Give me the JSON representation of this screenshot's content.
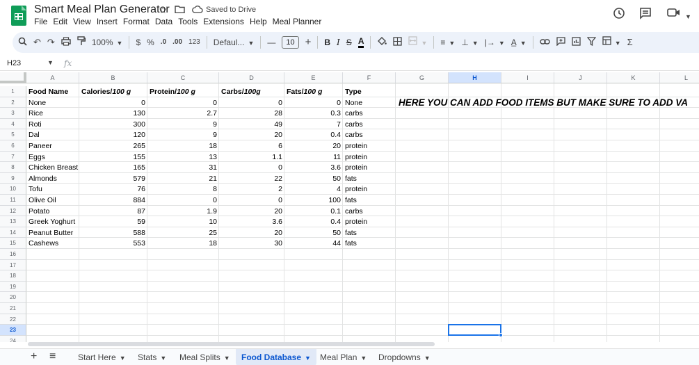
{
  "doc": {
    "title": "Smart Meal Plan Generator",
    "saved_status": "Saved to Drive"
  },
  "menu": [
    "File",
    "Edit",
    "View",
    "Insert",
    "Format",
    "Data",
    "Tools",
    "Extensions",
    "Help",
    "Meal Planner"
  ],
  "toolbar": {
    "zoom": "100%",
    "currency": "$",
    "percent": "%",
    "dec_decrease": ".0",
    "dec_increase": ".00",
    "number_format": "123",
    "font": "Defaul...",
    "font_size": "10",
    "minus": "—",
    "plus": "+",
    "bold": "B",
    "italic": "I",
    "strike": "S",
    "text_color": "A"
  },
  "formula_bar": {
    "cell_ref": "H23",
    "fx": "fx",
    "content": ""
  },
  "columns": [
    "A",
    "B",
    "C",
    "D",
    "E",
    "F",
    "G",
    "H",
    "I",
    "J",
    "K",
    "L"
  ],
  "rows": [
    "1",
    "2",
    "3",
    "4",
    "5",
    "6",
    "7",
    "8",
    "9",
    "10",
    "11",
    "12",
    "13",
    "14",
    "15",
    "16",
    "17",
    "18",
    "19",
    "20",
    "21",
    "22",
    "23",
    "24"
  ],
  "selected": {
    "column": "H",
    "row": "23"
  },
  "table": {
    "headers": {
      "food": "Food Name",
      "calories": "Calories/",
      "calories_unit": "100 g",
      "protein": "Protein/",
      "protein_unit": "100 g",
      "carbs": "Carbs/",
      "carbs_unit": "100g",
      "fats": "Fats/",
      "fats_unit": "100 g",
      "type": "Type"
    },
    "rows": [
      [
        "None",
        "0",
        "0",
        "0",
        "0",
        "None"
      ],
      [
        "Rice",
        "130",
        "2.7",
        "28",
        "0.3",
        "carbs"
      ],
      [
        "Roti",
        "300",
        "9",
        "49",
        "7",
        "carbs"
      ],
      [
        "Dal",
        "120",
        "9",
        "20",
        "0.4",
        "carbs"
      ],
      [
        "Paneer",
        "265",
        "18",
        "6",
        "20",
        "protein"
      ],
      [
        "Eggs",
        "155",
        "13",
        "1.1",
        "11",
        "protein"
      ],
      [
        "Chicken Breast",
        "165",
        "31",
        "0",
        "3.6",
        "protein"
      ],
      [
        "Almonds",
        "579",
        "21",
        "22",
        "50",
        "fats"
      ],
      [
        "Tofu",
        "76",
        "8",
        "2",
        "4",
        "protein"
      ],
      [
        "Olive Oil",
        "884",
        "0",
        "0",
        "100",
        "fats"
      ],
      [
        "Potato",
        "87",
        "1.9",
        "20",
        "0.1",
        "carbs"
      ],
      [
        "Greek Yoghurt",
        "59",
        "10",
        "3.6",
        "0.4",
        "protein"
      ],
      [
        "Peanut Butter",
        "588",
        "25",
        "20",
        "50",
        "fats"
      ],
      [
        "Cashews",
        "553",
        "18",
        "30",
        "44",
        "fats"
      ]
    ]
  },
  "note": "HERE YOU CAN ADD FOOD ITEMS BUT MAKE SURE TO ADD VA",
  "sheets": [
    {
      "label": "Start Here",
      "active": false
    },
    {
      "label": "Stats",
      "active": false
    },
    {
      "label": "Meal Splits",
      "active": false
    },
    {
      "label": "Food Database",
      "active": true
    },
    {
      "label": "Meal Plan",
      "active": false
    },
    {
      "label": "Dropdowns",
      "active": false
    }
  ],
  "colors": {
    "accent": "#0b57d0",
    "sheets_green": "#0f9d58",
    "toolbar_bg": "#edf2fa",
    "selection": "#1a73e8"
  }
}
